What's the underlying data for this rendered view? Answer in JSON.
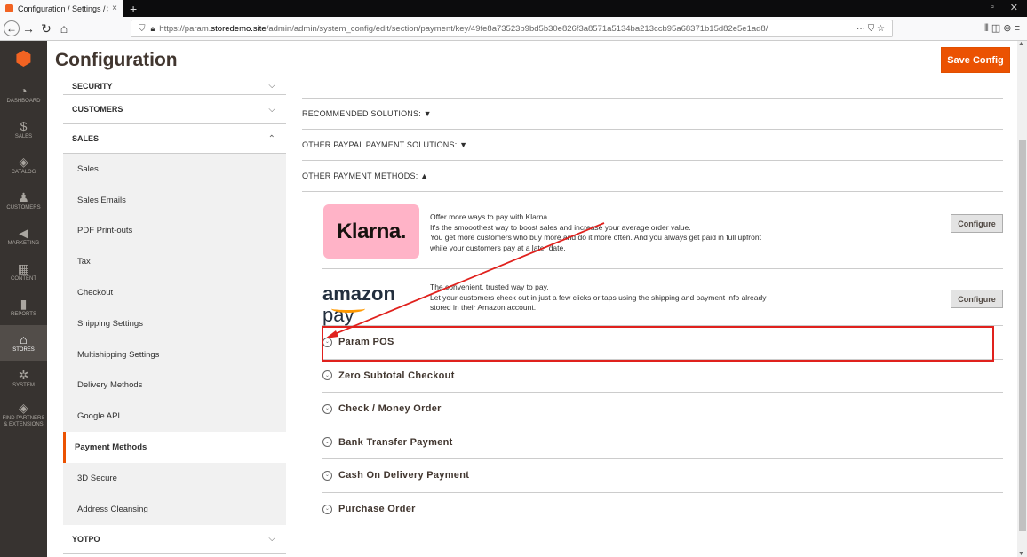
{
  "browser": {
    "tab_title": "Configuration / Settings / Store",
    "tab_close": "×",
    "new_tab": "+",
    "url_scheme": "https://param.",
    "url_host": "storedemo.site",
    "url_path": "/admin/admin/system_config/edit/section/payment/key/49fe8a73523b9bd5b30e826f3a8571a5134ba213ccb95a68371b15d82e5e1ad8/",
    "url_actions": "··· ⛉ ☆",
    "toolbar": "⫴ ◫ ⊛ ≡"
  },
  "admin_nav": {
    "logo": "⬢",
    "items": [
      {
        "label": "DASHBOARD",
        "icon": "dashboard-icon",
        "glyph": "◔"
      },
      {
        "label": "SALES",
        "icon": "dollar-icon",
        "glyph": "$"
      },
      {
        "label": "CATALOG",
        "icon": "box-icon",
        "glyph": "◈"
      },
      {
        "label": "CUSTOMERS",
        "icon": "person-icon",
        "glyph": "♟"
      },
      {
        "label": "MARKETING",
        "icon": "megaphone-icon",
        "glyph": "◀"
      },
      {
        "label": "CONTENT",
        "icon": "content-icon",
        "glyph": "▦"
      },
      {
        "label": "REPORTS",
        "icon": "bar-chart-icon",
        "glyph": "▮"
      },
      {
        "label": "STORES",
        "icon": "store-icon",
        "glyph": "⌂"
      },
      {
        "label": "SYSTEM",
        "icon": "gear-icon",
        "glyph": "✲"
      },
      {
        "label": "FIND PARTNERS & EXTENSIONS",
        "icon": "extensions-icon",
        "glyph": "◈"
      }
    ]
  },
  "header": {
    "title": "Configuration",
    "save_label": "Save Config"
  },
  "sidebar": {
    "groups": [
      {
        "label": "SECURITY",
        "chevron": "⌵"
      },
      {
        "label": "CUSTOMERS",
        "chevron": "⌵"
      },
      {
        "label": "SALES",
        "chevron": "⌃"
      }
    ],
    "sales_items": [
      "Sales",
      "Sales Emails",
      "PDF Print-outs",
      "Tax",
      "Checkout",
      "Shipping Settings",
      "Multishipping Settings",
      "Delivery Methods",
      "Google API",
      "Payment Methods",
      "3D Secure",
      "Address Cleansing"
    ],
    "bottom_group": {
      "label": "YOTPO",
      "chevron": "⌵"
    }
  },
  "main": {
    "top_cut_text": "...",
    "sections": {
      "recommended": "RECOMMENDED SOLUTIONS: ▼",
      "other_paypal": "OTHER PAYPAL PAYMENT SOLUTIONS: ▼",
      "other_methods": "OTHER PAYMENT METHODS: ▲"
    },
    "klarna": {
      "logo": "Klarna.",
      "line1": "Offer more ways to pay with Klarna.",
      "line2": "It's the smooothest way to boost sales and increase your average order value.",
      "line3": "You get more customers who buy more and do it more often. And you always get paid in full upfront while your customers pay at a later date.",
      "button": "Configure"
    },
    "amazon": {
      "logo_bold": "amazon",
      "logo_pay": " pay",
      "line1": "The convenient, trusted way to pay.",
      "line2": "Let your customers check out in just a few clicks or taps using the shipping and payment info already stored in their Amazon account.",
      "button": "Configure"
    },
    "accordion_glyph": "⌄",
    "accordions": [
      "Param POS",
      "Zero Subtotal Checkout",
      "Check / Money Order",
      "Bank Transfer Payment",
      "Cash On Delivery Payment",
      "Purchase Order"
    ]
  },
  "colors": {
    "accent": "#eb5202",
    "highlight": "#e0211d",
    "admin_nav_bg": "#373330"
  }
}
